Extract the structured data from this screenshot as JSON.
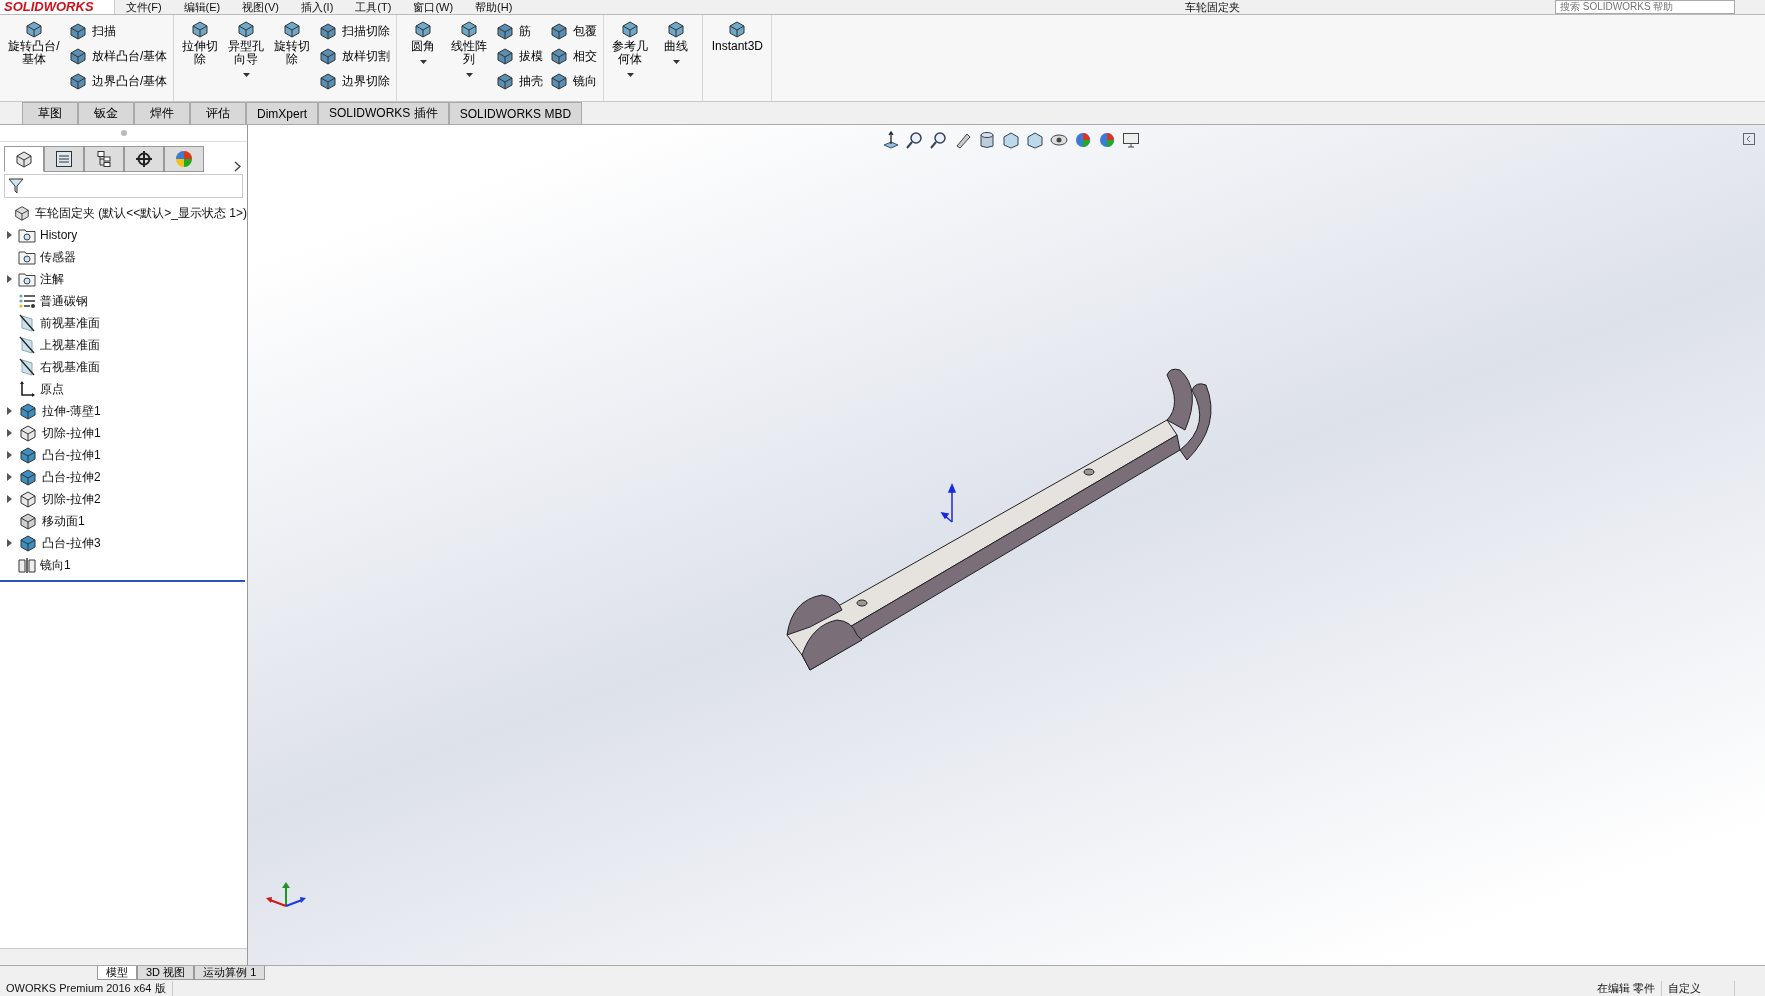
{
  "menu_bar": {
    "logo": "SOLIDWORKS",
    "items": [
      "文件(F)",
      "编辑(E)",
      "视图(V)",
      "插入(I)",
      "工具(T)",
      "窗口(W)",
      "帮助(H)"
    ],
    "title": "车轮固定夹",
    "search": {
      "placeholder": "搜索 SOLIDWORKS 帮助"
    }
  },
  "ribbon": {
    "groups": [
      {
        "large": [
          {
            "label": "旋转凸台/基体",
            "dropdown": false
          }
        ],
        "small": [
          [
            "扫描",
            "放样凸台/基体",
            "边界凸台/基体"
          ]
        ]
      },
      {
        "large": [
          {
            "label": "拉伸切除",
            "dropdown": false
          },
          {
            "label": "异型孔向导",
            "dropdown": true
          },
          {
            "label": "旋转切除",
            "dropdown": false
          }
        ],
        "small": [
          [
            "扫描切除",
            "放样切割",
            "边界切除"
          ]
        ]
      },
      {
        "large": [
          {
            "label": "圆角",
            "dropdown": true
          },
          {
            "label": "线性阵列",
            "dropdown": true
          }
        ],
        "small": [
          [
            "筋",
            "拔模",
            "抽壳"
          ],
          [
            "包覆",
            "相交",
            "镜向"
          ]
        ]
      },
      {
        "large": [
          {
            "label": "参考几何体",
            "dropdown": true
          },
          {
            "label": "曲线",
            "dropdown": true
          }
        ]
      },
      {
        "large": [
          {
            "label": "Instant3D",
            "dropdown": false
          }
        ]
      }
    ]
  },
  "command_tabs": [
    {
      "label": "草图",
      "selected": false
    },
    {
      "label": "钣金",
      "selected": false
    },
    {
      "label": "焊件",
      "selected": false
    },
    {
      "label": "评估",
      "selected": false
    },
    {
      "label": "DimXpert",
      "selected": false
    },
    {
      "label": "SOLIDWORKS 插件",
      "selected": false
    },
    {
      "label": "SOLIDWORKS MBD",
      "selected": false
    }
  ],
  "panel_tabs": [
    {
      "kind": "features",
      "selected": true
    },
    {
      "kind": "properties",
      "selected": false
    },
    {
      "kind": "configurations",
      "selected": false
    },
    {
      "kind": "dimxpert",
      "selected": false
    },
    {
      "kind": "display",
      "selected": false
    }
  ],
  "feature_tree": {
    "root": "车轮固定夹  (默认<<默认>_显示状态 1>)",
    "items": [
      {
        "label": "History",
        "kind": "history",
        "expandable": true
      },
      {
        "label": "传感器",
        "kind": "sensor",
        "expandable": false
      },
      {
        "label": "注解",
        "kind": "annotation",
        "expandable": true
      },
      {
        "label": "普通碳钢",
        "kind": "material",
        "expandable": false
      },
      {
        "label": "前视基准面",
        "kind": "plane",
        "expandable": false
      },
      {
        "label": "上视基准面",
        "kind": "plane",
        "expandable": false
      },
      {
        "label": "右视基准面",
        "kind": "plane",
        "expandable": false
      },
      {
        "label": "原点",
        "kind": "origin",
        "expandable": false
      },
      {
        "label": "拉伸-薄壁1",
        "kind": "boss",
        "expandable": true
      },
      {
        "label": "切除-拉伸1",
        "kind": "cut",
        "expandable": true
      },
      {
        "label": "凸台-拉伸1",
        "kind": "boss",
        "expandable": true
      },
      {
        "label": "凸台-拉伸2",
        "kind": "boss",
        "expandable": true
      },
      {
        "label": "切除-拉伸2",
        "kind": "cut",
        "expandable": true
      },
      {
        "label": "移动面1",
        "kind": "move",
        "expandable": false
      },
      {
        "label": "凸台-拉伸3",
        "kind": "boss",
        "expandable": true
      },
      {
        "label": "镜向1",
        "kind": "mirror",
        "expandable": false
      }
    ]
  },
  "model_tabs": [
    {
      "label": "模型",
      "selected": true
    },
    {
      "label": "3D 视图",
      "selected": false
    },
    {
      "label": "运动算例 1",
      "selected": false
    }
  ],
  "status_bar": {
    "left": "OWORKS Premium 2016 x64 版",
    "editing": "在编辑 零件",
    "units": "自定义"
  }
}
